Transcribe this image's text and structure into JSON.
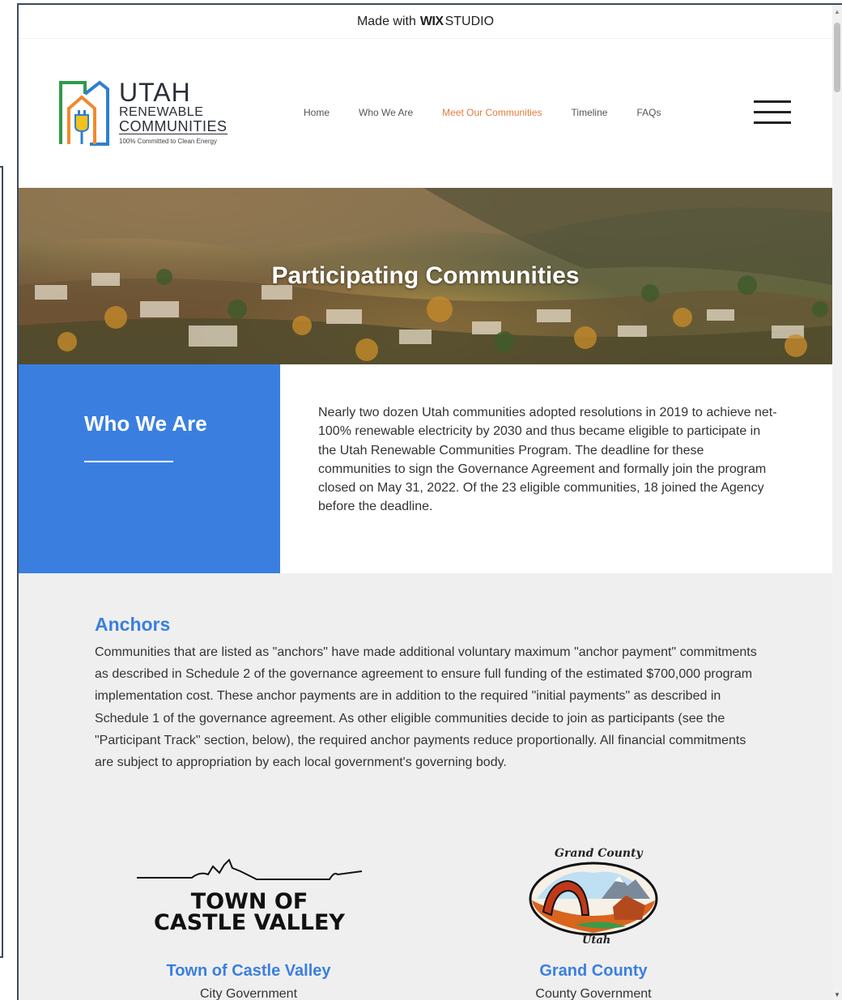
{
  "banner": {
    "prefix": "Made with",
    "brand": "WIX",
    "suffix": "STUDIO"
  },
  "logo": {
    "line1": "UTAH",
    "line2": "RENEWABLE",
    "line3": "COMMUNITIES",
    "tagline": "100% Committed to Clean Energy",
    "colors": {
      "orange": "#f08a2e",
      "green": "#2e9a4a",
      "blue": "#2e7fd0",
      "yellow": "#f2c21e"
    }
  },
  "nav": {
    "items": [
      {
        "label": "Home"
      },
      {
        "label": "Who We Are"
      },
      {
        "label": "Meet Our Communities",
        "active": true
      },
      {
        "label": "Timeline"
      },
      {
        "label": "FAQs"
      }
    ],
    "menu_icon": "hamburger-icon"
  },
  "hero": {
    "title": "Participating Communities"
  },
  "who": {
    "title": "Who We Are",
    "body": "Nearly two dozen Utah communities adopted resolutions in 2019 to achieve net-100% renewable electricity by 2030 and thus became eligible to participate in the Utah Renewable Communities Program. The deadline for these communities to sign the Governance Agreement and formally join the program closed on May 31, 2022. Of the 23 eligible communities, 18 joined the Agency before the deadline."
  },
  "anchors": {
    "title": "Anchors",
    "body": "Communities that are listed as \"anchors\" have made additional voluntary maximum \"anchor payment\" commitments as described in Schedule 2 of the governance agreement to ensure full funding of the estimated $700,000 program implementation cost. These anchor payments are in addition to the required \"initial payments\" as described in Schedule 1 of the governance agreement. As other eligible communities decide to join as participants (see the \"Participant Track\" section, below), the required anchor payments reduce proportionally. All financial commitments are subject to appropriation by each local government's governing body."
  },
  "communities": [
    {
      "name": "Town of Castle Valley",
      "type": "City Government",
      "logo_line1": "TOWN OF",
      "logo_line2": "CASTLE VALLEY"
    },
    {
      "name": "Grand County",
      "type": "County Government",
      "logo_top": "Grand County",
      "logo_bottom": "Utah"
    }
  ],
  "colors": {
    "accent_blue": "#3a7fe0",
    "nav_active": "#e07a3e",
    "anchors_bg": "#efefef"
  }
}
